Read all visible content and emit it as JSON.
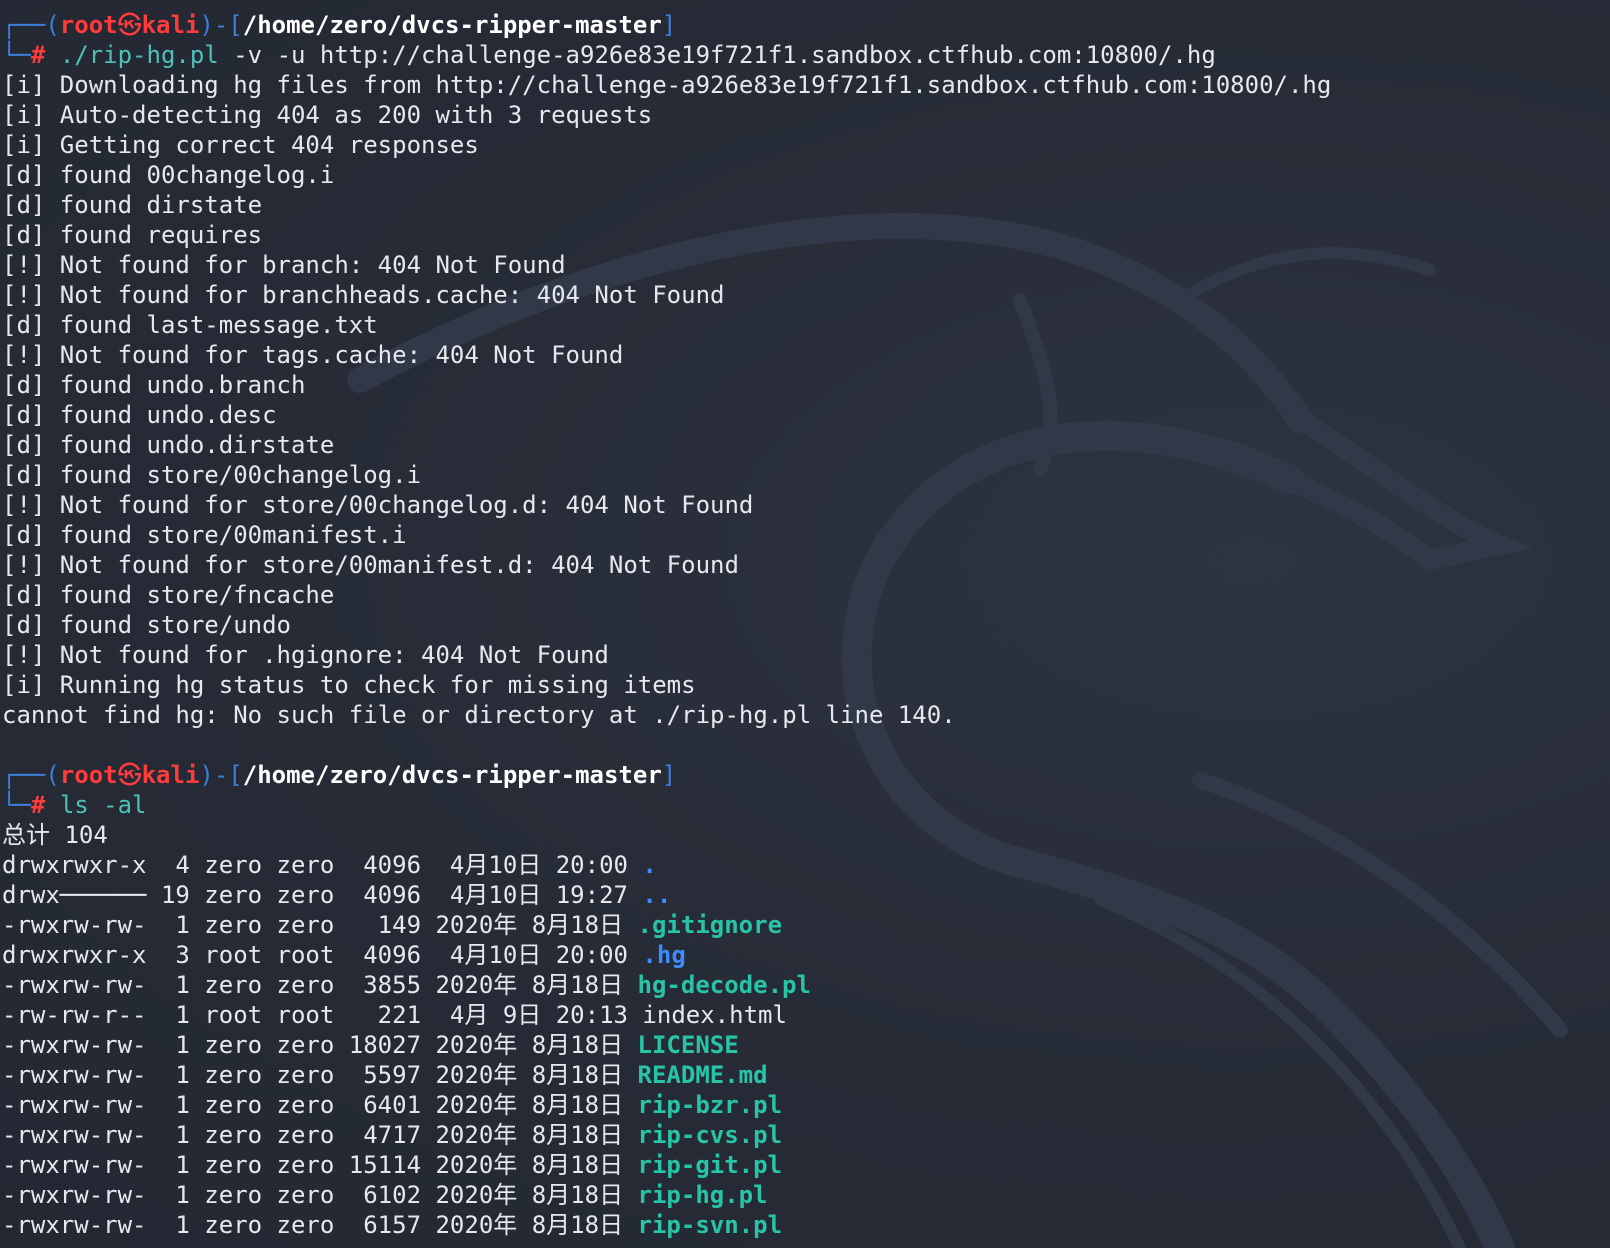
{
  "prompt": {
    "user": "root",
    "symbol": "㉿",
    "host": "kali",
    "cwd": "/home/zero/dvcs-ripper-master",
    "hash": "#"
  },
  "commands": [
    {
      "cmd": "./rip-hg.pl",
      "args": " -v -u http://challenge-a926e83e19f721f1.sandbox.ctfhub.com:10800/.hg"
    },
    {
      "cmd": "ls -al",
      "args": ""
    }
  ],
  "output1": [
    "[i] Downloading hg files from http://challenge-a926e83e19f721f1.sandbox.ctfhub.com:10800/.hg",
    "[i] Auto-detecting 404 as 200 with 3 requests",
    "[i] Getting correct 404 responses",
    "[d] found 00changelog.i",
    "[d] found dirstate",
    "[d] found requires",
    "[!] Not found for branch: 404 Not Found",
    "[!] Not found for branchheads.cache: 404 Not Found",
    "[d] found last-message.txt",
    "[!] Not found for tags.cache: 404 Not Found",
    "[d] found undo.branch",
    "[d] found undo.desc",
    "[d] found undo.dirstate",
    "[d] found store/00changelog.i",
    "[!] Not found for store/00changelog.d: 404 Not Found",
    "[d] found store/00manifest.i",
    "[!] Not found for store/00manifest.d: 404 Not Found",
    "[d] found store/fncache",
    "[d] found store/undo",
    "[!] Not found for .hgignore: 404 Not Found",
    "[i] Running hg status to check for missing items",
    "cannot find hg: No such file or directory at ./rip-hg.pl line 140."
  ],
  "ls": {
    "total": "总计 104",
    "rows": [
      {
        "meta": "drwxrwxr-x  4 zero zero  4096  4月10日 20:00 ",
        "name": ".",
        "style": "dir"
      },
      {
        "meta": "drwx────── 19 zero zero  4096  4月10日 19:27 ",
        "name": "..",
        "style": "dir"
      },
      {
        "meta": "-rwxrw-rw-  1 zero zero   149 2020年 8月18日 ",
        "name": ".gitignore",
        "style": "file-b"
      },
      {
        "meta": "drwxrwxr-x  3 root root  4096  4月10日 20:00 ",
        "name": ".hg",
        "style": "dir"
      },
      {
        "meta": "-rwxrw-rw-  1 zero zero  3855 2020年 8月18日 ",
        "name": "hg-decode.pl",
        "style": "file-b"
      },
      {
        "meta": "-rw-rw-r--  1 root root   221  4月 9日 20:13 ",
        "name": "index.html",
        "style": "file-n"
      },
      {
        "meta": "-rwxrw-rw-  1 zero zero 18027 2020年 8月18日 ",
        "name": "LICENSE",
        "style": "file-b"
      },
      {
        "meta": "-rwxrw-rw-  1 zero zero  5597 2020年 8月18日 ",
        "name": "README.md",
        "style": "file-b"
      },
      {
        "meta": "-rwxrw-rw-  1 zero zero  6401 2020年 8月18日 ",
        "name": "rip-bzr.pl",
        "style": "file-b"
      },
      {
        "meta": "-rwxrw-rw-  1 zero zero  4717 2020年 8月18日 ",
        "name": "rip-cvs.pl",
        "style": "file-b"
      },
      {
        "meta": "-rwxrw-rw-  1 zero zero 15114 2020年 8月18日 ",
        "name": "rip-git.pl",
        "style": "file-b"
      },
      {
        "meta": "-rwxrw-rw-  1 zero zero  6102 2020年 8月18日 ",
        "name": "rip-hg.pl",
        "style": "file-b"
      },
      {
        "meta": "-rwxrw-rw-  1 zero zero  6157 2020年 8月18日 ",
        "name": "rip-svn.pl",
        "style": "file-b"
      }
    ]
  },
  "colors": {
    "background": "#262b36",
    "prompt_frame": "#3d7fd9",
    "prompt_user": "#ff3b3b",
    "command": "#4fc0b8",
    "directory": "#3d8bff",
    "file": "#27c4a8"
  },
  "background_graphic": "kali-dragon-watermark"
}
